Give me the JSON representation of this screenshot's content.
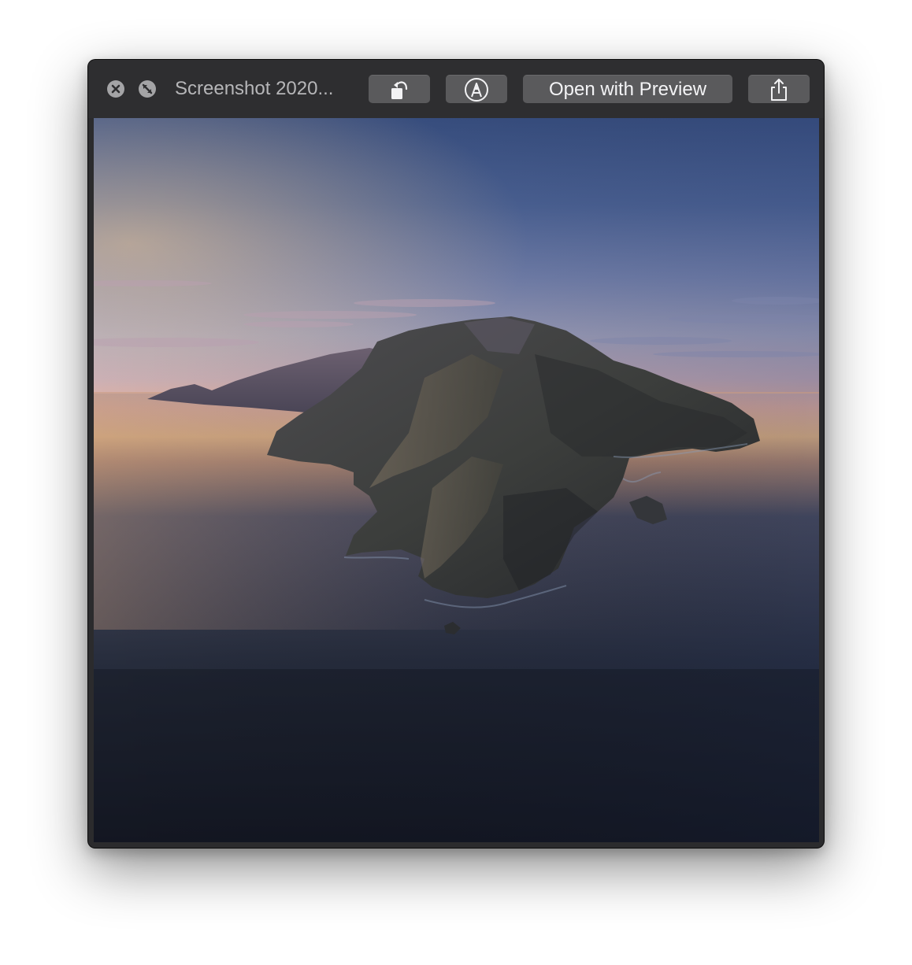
{
  "window": {
    "title": "Screenshot 2020..."
  },
  "toolbar": {
    "close_icon": "close-circle-icon",
    "fullscreen_icon": "fullscreen-circle-icon",
    "rotate_icon": "rotate-left-icon",
    "markup_icon": "markup-pen-icon",
    "open_with_label": "Open with Preview",
    "share_icon": "share-icon"
  },
  "image": {
    "subject": "island-landscape-photo"
  },
  "colors": {
    "window_bg": "#2b2b2d",
    "button_bg": "#5a5a5c",
    "title_text": "#b6b6b8"
  }
}
